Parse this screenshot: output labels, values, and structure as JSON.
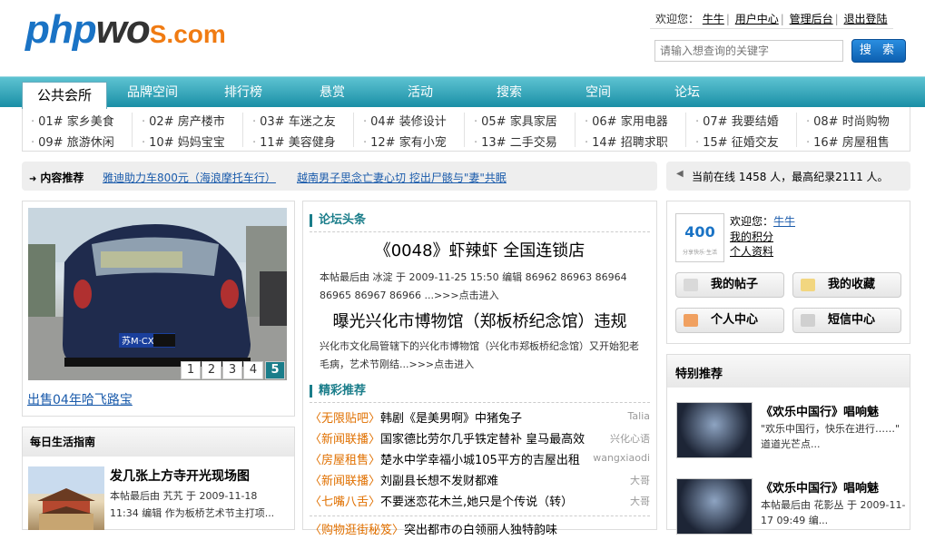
{
  "logo": {
    "part1": "php",
    "part2": "wo",
    "part3": "S.com"
  },
  "userbar": {
    "greeting": "欢迎您：",
    "username": "牛牛",
    "user_center": "用户中心",
    "admin": "管理后台",
    "logout": "退出登陆"
  },
  "search": {
    "placeholder": "请输入想查询的关键字",
    "button": "搜 索"
  },
  "nav": {
    "active": "公共会所",
    "tabs": [
      "品牌空间",
      "排行榜",
      "悬赏",
      "活动",
      "搜索",
      "空间",
      "论坛"
    ]
  },
  "categories": [
    "01# 家乡美食",
    "02# 房产楼市",
    "03# 车迷之友",
    "04# 装修设计",
    "05# 家具家居",
    "06# 家用电器",
    "07# 我要结婚",
    "08# 时尚购物",
    "09# 旅游休闲",
    "10# 妈妈宝宝",
    "11# 美容健身",
    "12# 家有小宠",
    "13# 二手交易",
    "14# 招聘求职",
    "15# 征婚交友",
    "16# 房屋租售"
  ],
  "recommend": {
    "label": "内容推荐",
    "links": [
      "雅迪助力车800元（海浪摩托车行）",
      "越南男子思念亡妻心切 挖出尸骸与\"妻\"共眠"
    ]
  },
  "online": {
    "text": "当前在线 1458 人，最高纪录2111 人。"
  },
  "photo": {
    "plate": "苏M·CX",
    "pages": [
      "1",
      "2",
      "3",
      "4",
      "5"
    ],
    "active_page": "5",
    "caption": "出售04年哈飞路宝"
  },
  "guide": {
    "header": "每日生活指南",
    "title": "发几张上方寺开光现场图",
    "meta": "本帖最后由 艽艽 于 2009-11-18 11:34 编辑 作为板桥艺术节主打项..."
  },
  "forum": {
    "header1": "论坛头条",
    "headline1": "《0048》虾辣虾 全国连锁店",
    "meta1": "本帖最后由 冰淀 于 2009-11-25 15:50 编辑 86962 86963 86964 86965 86967 86966 ...>>>点击进入",
    "headline2": "曝光兴化市博物馆（郑板桥纪念馆）违规",
    "meta2": "兴化市文化局管辖下的兴化市博物馆（兴化市郑板桥纪念馆）又开始犯老毛病，艺术节刚结...>>>点击进入",
    "header2": "精彩推荐",
    "posts": [
      {
        "tag": "〈无限贴吧〉",
        "title": "韩剧《是美男啊》中猪兔子",
        "author": "Talia"
      },
      {
        "tag": "〈新闻联播〉",
        "title": "国家德比劳尔几乎铁定替补 皇马最高效",
        "author": "兴化心语"
      },
      {
        "tag": "〈房屋租售〉",
        "title": "楚水中学幸福小城105平方的吉屋出租",
        "author": "wangxiaodi"
      },
      {
        "tag": "〈新闻联播〉",
        "title": "刘副县长想不发财都难",
        "author": "大哥"
      },
      {
        "tag": "〈七嘴八舌〉",
        "title": "不要迷恋花木兰,她只是个传说（转）",
        "author": "大哥"
      },
      {
        "tag": "〈购物逛街秘笈〉",
        "title": "突出都市の白领丽人独特韵味",
        "author": ""
      }
    ]
  },
  "user": {
    "avatar_text": "400",
    "avatar_sub": "分享快乐·生活",
    "welcome": "欢迎您：",
    "name": "牛牛",
    "points": "我的积分",
    "profile": "个人资料",
    "buttons": [
      "我的帖子",
      "我的收藏",
      "个人中心",
      "短信中心"
    ]
  },
  "special": {
    "header": "特别推荐",
    "items": [
      {
        "title": "《欢乐中国行》唱响魅",
        "desc": "\"欢乐中国行，快乐在进行……\" 道道光芒点..."
      },
      {
        "title": "《欢乐中国行》唱响魅",
        "desc": "本帖最后由 花影丛 于 2009-11-17 09:49 编..."
      }
    ]
  }
}
